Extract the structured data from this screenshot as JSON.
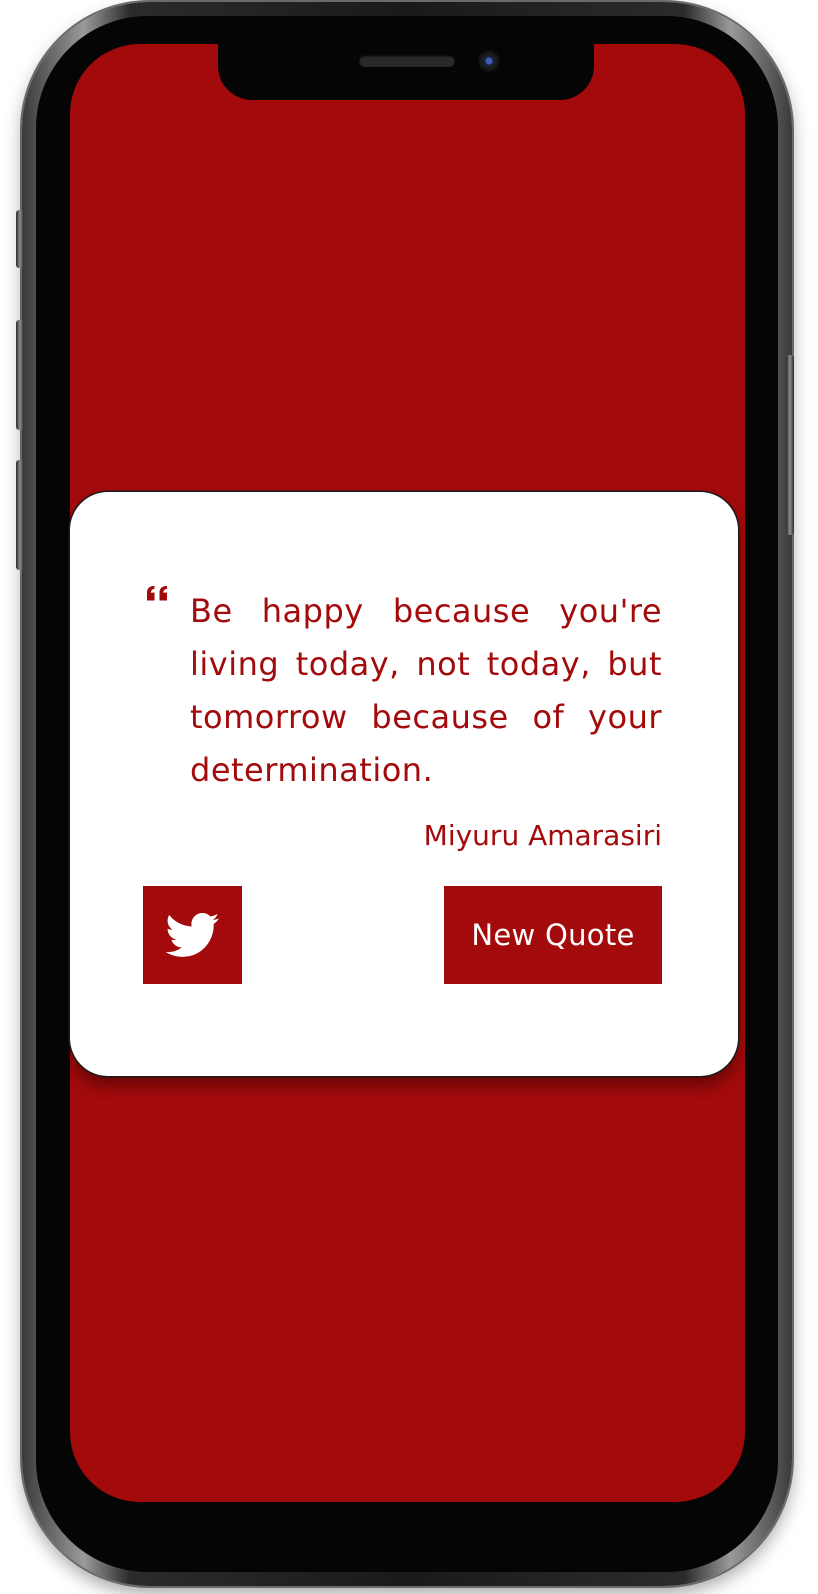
{
  "quote": {
    "text": "Be happy because you're living today, not today, but tomorrow because of your determination.",
    "author": "Miyuru Amarasiri",
    "quote_icon": "quote-left-icon"
  },
  "actions": {
    "tweet_icon": "twitter-bird-icon",
    "new_quote_label": "New Quote"
  },
  "colors": {
    "background": "#a20a0b",
    "card": "#ffffff",
    "accent": "#a20a0b",
    "button_text": "#ffffff"
  }
}
